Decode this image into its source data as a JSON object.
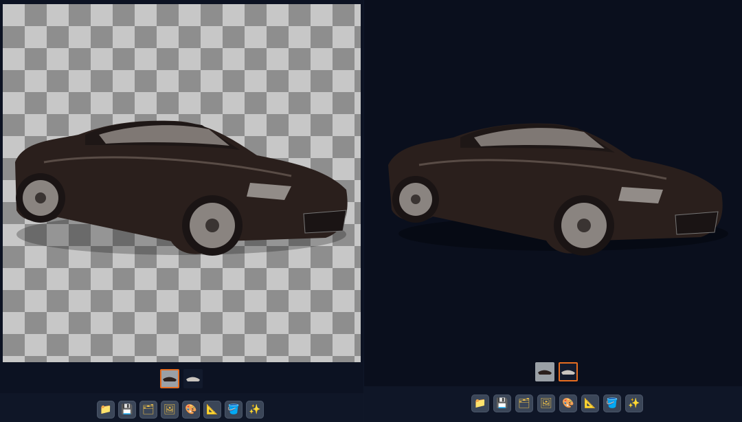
{
  "editor": {
    "left_panel": {
      "thumbs": [
        {
          "name": "original",
          "active": true
        },
        {
          "name": "processed",
          "active": false
        }
      ]
    },
    "right_panel": {
      "thumbs": [
        {
          "name": "original",
          "active": false
        },
        {
          "name": "processed",
          "active": true
        }
      ]
    },
    "toolbar": {
      "items": [
        {
          "name": "open-folder",
          "glyph": "📁"
        },
        {
          "name": "save",
          "glyph": "💾"
        },
        {
          "name": "layers",
          "glyph": "🗂"
        },
        {
          "name": "image",
          "glyph": "🖼"
        },
        {
          "name": "palette",
          "glyph": "🎨"
        },
        {
          "name": "ruler",
          "glyph": "📐"
        },
        {
          "name": "stack",
          "glyph": "🪣"
        },
        {
          "name": "magic",
          "glyph": "✨"
        }
      ]
    }
  },
  "colors": {
    "background": "#0a0f1d",
    "toolbar": "#0f1627",
    "tool_button": "#3b4658",
    "active_border": "#e76d20",
    "checker_light": "#c7c7c7",
    "checker_dark": "#8e8e8e"
  }
}
